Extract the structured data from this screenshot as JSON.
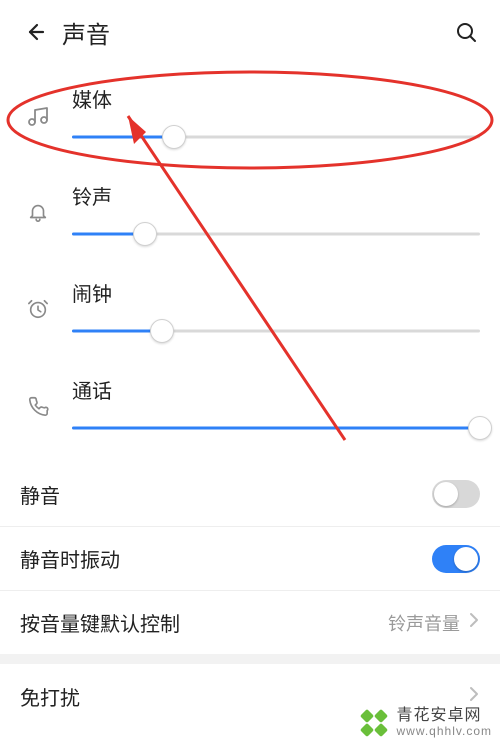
{
  "header": {
    "title": "声音"
  },
  "sliders": {
    "media": {
      "label": "媒体",
      "percent": 25
    },
    "ring": {
      "label": "铃声",
      "percent": 18
    },
    "alarm": {
      "label": "闹钟",
      "percent": 22
    },
    "call": {
      "label": "通话",
      "percent": 100
    }
  },
  "rows": {
    "mute": {
      "label": "静音",
      "on": false
    },
    "vibrate_on_mute": {
      "label": "静音时振动",
      "on": true
    },
    "volume_key_default": {
      "label": "按音量键默认控制",
      "value": "铃声音量"
    },
    "dnd": {
      "label": "免打扰"
    }
  },
  "watermark": {
    "line1": "青花安卓网",
    "line2": "www.qhhlv.com"
  },
  "colors": {
    "accent": "#2f81f7",
    "annotation": "#e4322b",
    "watermark_green": "#6abf3a"
  }
}
